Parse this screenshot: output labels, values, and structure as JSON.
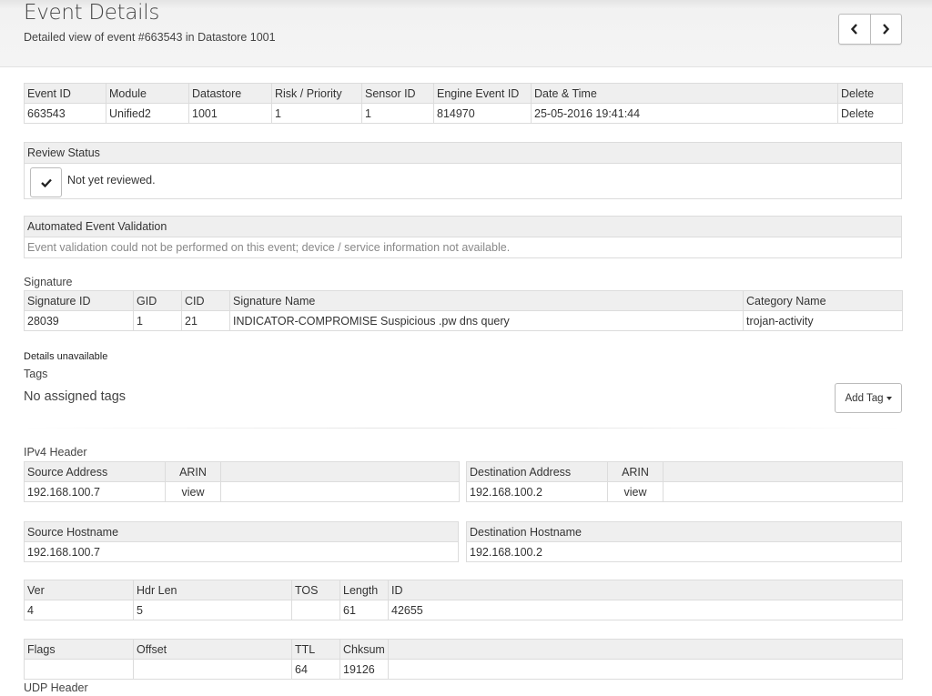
{
  "header": {
    "title": "Event Details",
    "subtitle": "Detailed view of event #663543 in Datastore 1001"
  },
  "event": {
    "headers": [
      "Event ID",
      "Module",
      "Datastore",
      "Risk / Priority",
      "Sensor ID",
      "Engine Event ID",
      "Date & Time",
      "Delete"
    ],
    "values": [
      "663543",
      "Unified2",
      "1001",
      "1",
      "1",
      "814970",
      "25-05-2016 19:41:44",
      "Delete"
    ]
  },
  "review": {
    "title": "Review Status",
    "status_text": "Not yet reviewed."
  },
  "validation": {
    "title": "Automated Event Validation",
    "message": "Event validation could not be performed on this event; device / service information not available."
  },
  "signature": {
    "section_label": "Signature",
    "headers": [
      "Signature ID",
      "GID",
      "CID",
      "Signature Name",
      "Category Name"
    ],
    "values": [
      "28039",
      "1",
      "21",
      "INDICATOR-COMPROMISE Suspicious .pw dns query",
      "trojan-activity"
    ]
  },
  "details_unavailable": "Details unavailable",
  "tags": {
    "label": "Tags",
    "empty_text": "No assigned tags",
    "add_button": "Add Tag"
  },
  "ipv4": {
    "section_label": "IPv4 Header",
    "source": {
      "headers": [
        "Source Address",
        "ARIN",
        ""
      ],
      "values": [
        "192.168.100.7",
        "view",
        ""
      ]
    },
    "destination": {
      "headers": [
        "Destination Address",
        "ARIN",
        ""
      ],
      "values": [
        "192.168.100.2",
        "view",
        ""
      ]
    },
    "source_hostname": {
      "header": "Source Hostname",
      "value": "192.168.100.7"
    },
    "destination_hostname": {
      "header": "Destination Hostname",
      "value": "192.168.100.2"
    },
    "row1": {
      "headers": [
        "Ver",
        "Hdr Len",
        "TOS",
        "Length",
        "ID"
      ],
      "values": [
        "4",
        "5",
        "",
        "61",
        "42655"
      ]
    },
    "row2": {
      "headers": [
        "Flags",
        "Offset",
        "TTL",
        "Chksum",
        ""
      ],
      "values": [
        "",
        "",
        "64",
        "19126",
        ""
      ]
    }
  },
  "udp": {
    "section_label": "UDP Header"
  },
  "icons": {
    "prev": "chevron-left-icon",
    "next": "chevron-right-icon",
    "review": "check-icon",
    "dropdown": "caret-down-icon"
  }
}
